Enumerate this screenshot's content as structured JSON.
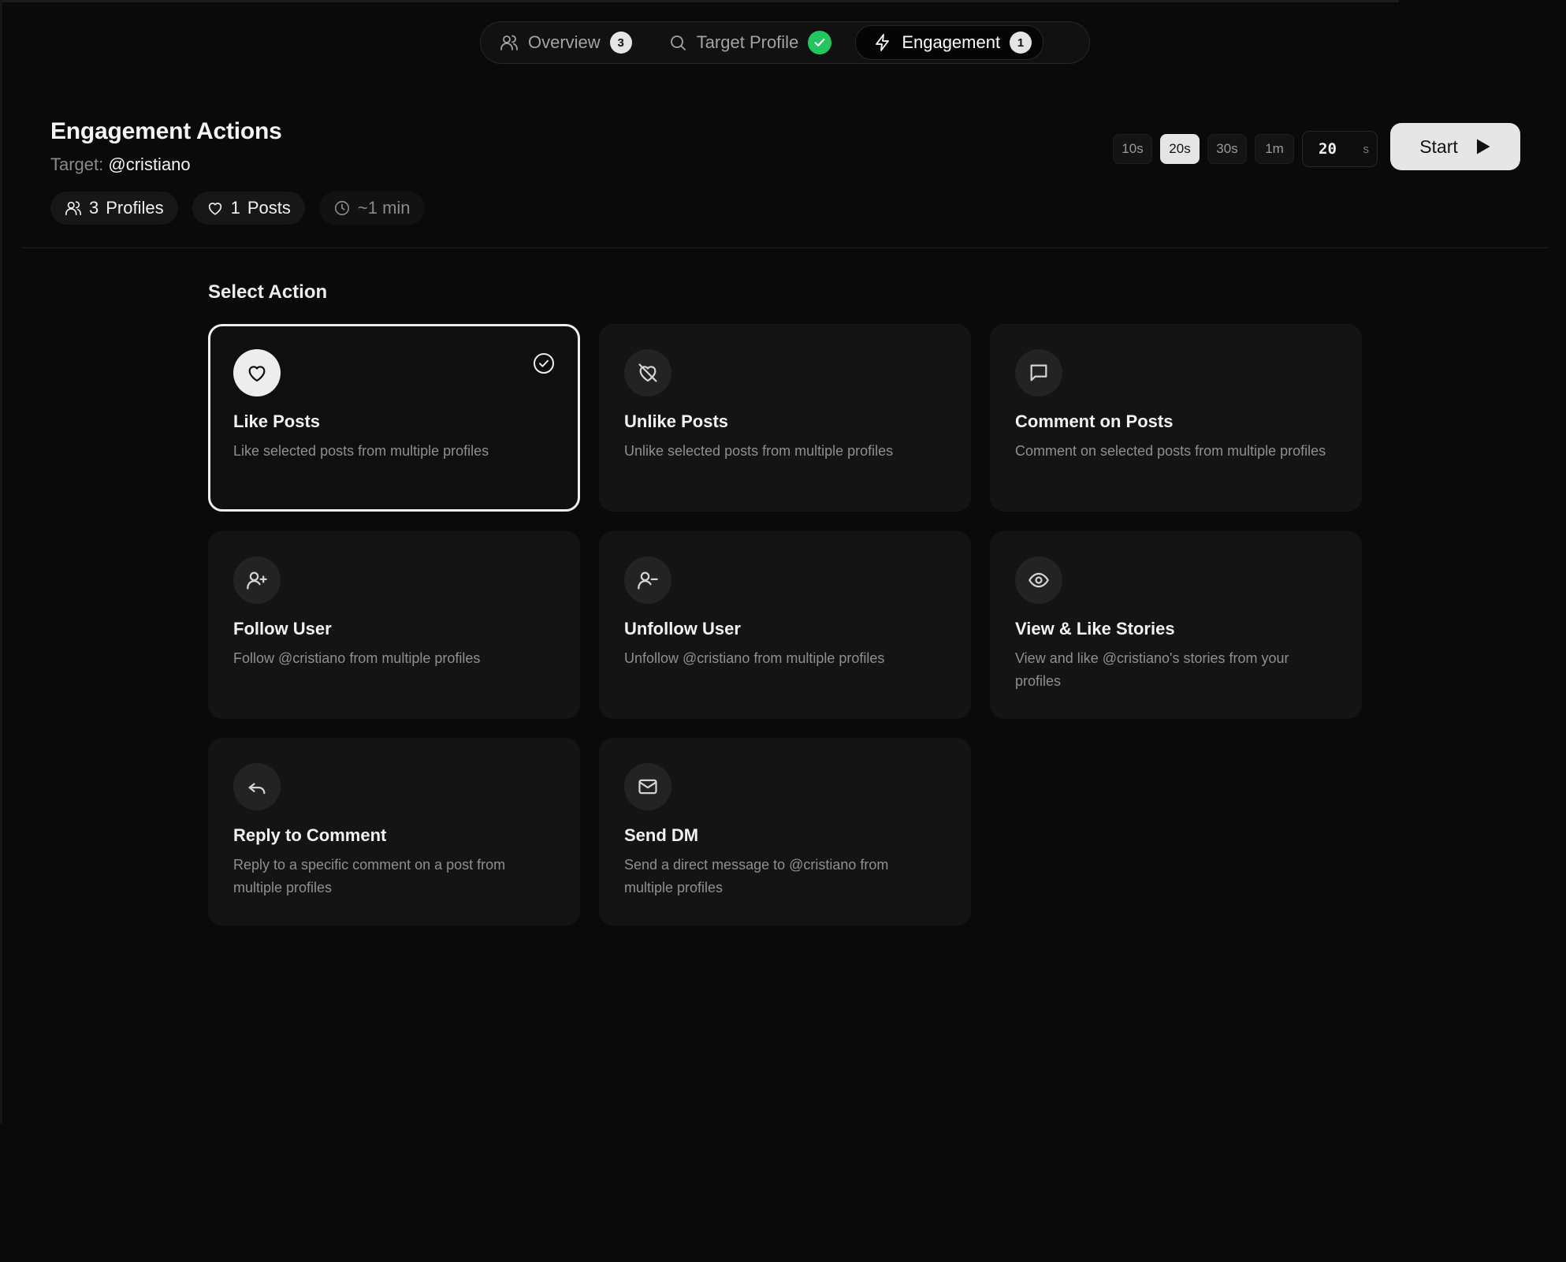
{
  "stepper": {
    "steps": [
      {
        "label": "Overview",
        "badge": "3",
        "icon": "users-icon"
      },
      {
        "label": "Target Profile",
        "badge": "✓",
        "icon": "search-icon"
      },
      {
        "label": "Engagement",
        "badge": "1",
        "icon": "lightning-icon"
      }
    ],
    "active_step": "Engagement",
    "colors": {
      "completed": "#22c55e"
    }
  },
  "header": {
    "title": "Engagement Actions",
    "target_label": "Target:",
    "target_handle": "@cristiano",
    "stats": [
      {
        "count": "3",
        "label": "Profiles",
        "icon": "users-icon"
      },
      {
        "count": "1",
        "label": "Posts",
        "icon": "heart-icon"
      },
      {
        "text": "~1 min",
        "icon": "clock-icon"
      }
    ]
  },
  "delay": {
    "presets": [
      "10s",
      "20s",
      "30s",
      "1m"
    ],
    "selected": "20s",
    "custom_value": "20",
    "unit": "s"
  },
  "start_button": {
    "label": "Start",
    "icon": "play-icon"
  },
  "actions_section": {
    "title": "Select Action",
    "selected": "Like Posts",
    "cards": [
      {
        "title": "Like Posts",
        "description": "Like selected posts from multiple profiles",
        "icon": "heart-icon"
      },
      {
        "title": "Unlike Posts",
        "description": "Unlike selected posts from multiple profiles",
        "icon": "heart-off-icon"
      },
      {
        "title": "Comment on Posts",
        "description": "Comment on selected posts from multiple profiles",
        "icon": "comment-icon"
      },
      {
        "title": "Follow User",
        "description": "Follow @cristiano from multiple profiles",
        "icon": "user-plus-icon"
      },
      {
        "title": "Unfollow User",
        "description": "Unfollow @cristiano from multiple profiles",
        "icon": "user-minus-icon"
      },
      {
        "title": "View & Like Stories",
        "description": "View and like @cristiano's stories from your profiles",
        "icon": "eye-icon"
      },
      {
        "title": "Reply to Comment",
        "description": "Reply to a specific comment on a post from multiple profiles",
        "icon": "reply-icon"
      },
      {
        "title": "Send DM",
        "description": "Send a direct message to @cristiano from multiple profiles",
        "icon": "mail-icon"
      }
    ]
  }
}
